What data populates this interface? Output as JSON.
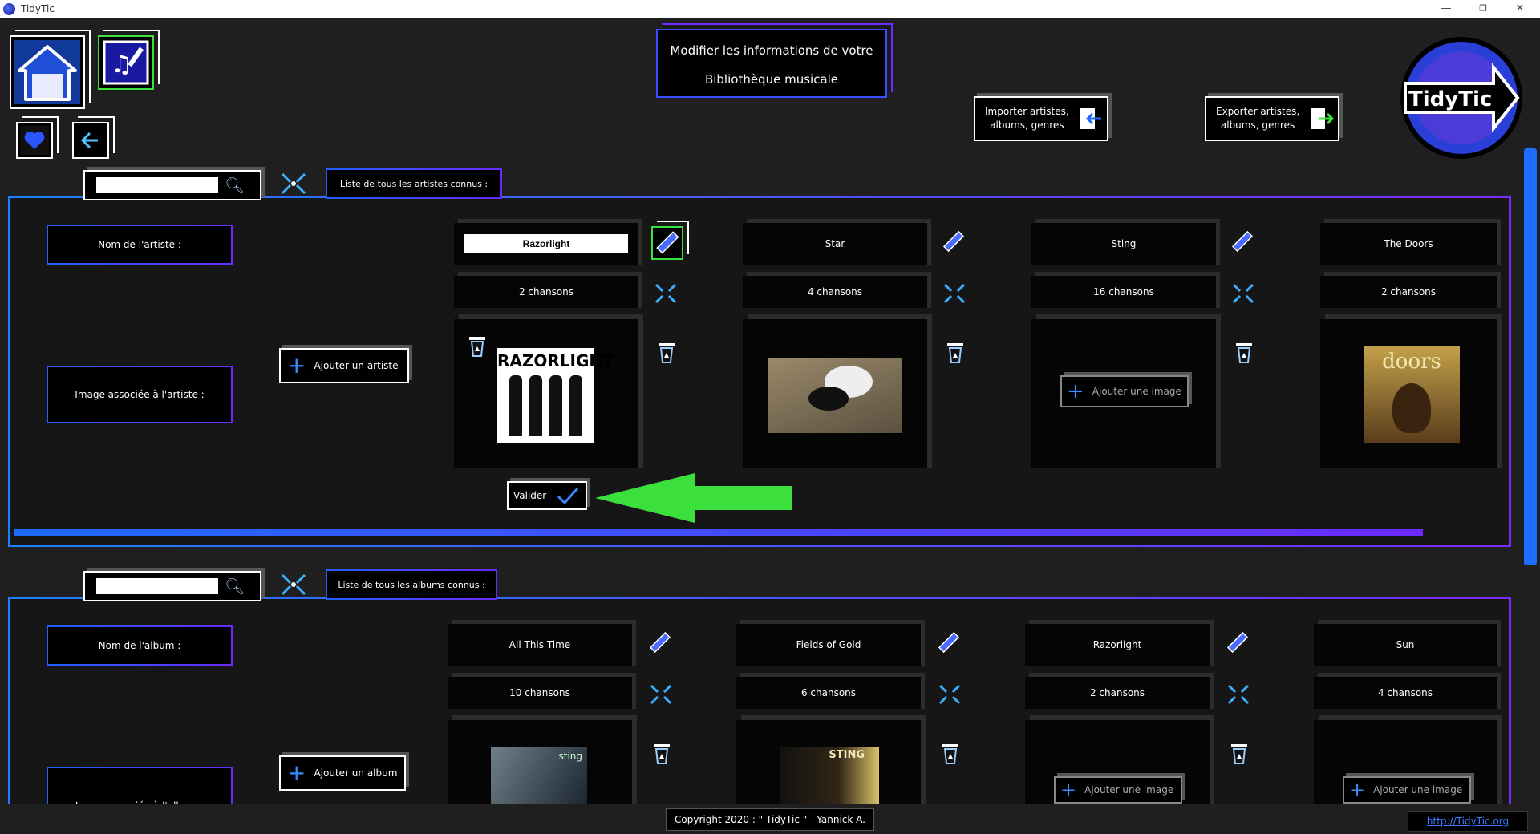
{
  "window": {
    "title": "TidyTic",
    "minimize": "—",
    "restore": "❐",
    "close": "✕"
  },
  "header": {
    "title_line1": "Modifier les informations de votre",
    "title_line2": "Bibliothèque musicale",
    "import_label_1": "Importer artistes,",
    "import_label_2": "albums, genres",
    "export_label_1": "Exporter artistes,",
    "export_label_2": "albums, genres",
    "logo_text": "TidyTic"
  },
  "artists_section": {
    "search_placeholder": "",
    "list_label": "Liste de tous les artistes connus :",
    "name_label": "Nom de l'artiste :",
    "image_label": "Image associée à l'artiste :",
    "add_button": "Ajouter un artiste",
    "validate_button": "Valider",
    "items": [
      {
        "name": "Razorlight",
        "count": "2 chansons",
        "image_text": "RAZORLIGHT"
      },
      {
        "name": "Star",
        "count": "4 chansons"
      },
      {
        "name": "Sting",
        "count": "16 chansons",
        "add_image": "Ajouter une image"
      },
      {
        "name": "The Doors",
        "count": "2 chansons",
        "image_text": "doors"
      }
    ]
  },
  "albums_section": {
    "search_placeholder": "",
    "list_label": "Liste de tous les albums connus :",
    "name_label": "Nom de l'album :",
    "image_label": "Image associée à l'album :",
    "add_button": "Ajouter un album",
    "items": [
      {
        "name": "All This Time",
        "count": "10 chansons",
        "image_text": "sting"
      },
      {
        "name": "Fields of Gold",
        "count": "6 chansons",
        "image_text": "STING"
      },
      {
        "name": "Razorlight",
        "count": "2 chansons",
        "add_image": "Ajouter une image"
      },
      {
        "name": "Sun",
        "count": "4 chansons",
        "add_image": "Ajouter une image"
      }
    ]
  },
  "footer": {
    "copyright": "Copyright 2020 : \" TidyTic \" - Yannick A.",
    "link": "http://TidyTic.org"
  },
  "colors": {
    "accent_blue": "#1e6bff",
    "accent_purple": "#6b2bff",
    "green_arrow": "#3ce03c"
  }
}
